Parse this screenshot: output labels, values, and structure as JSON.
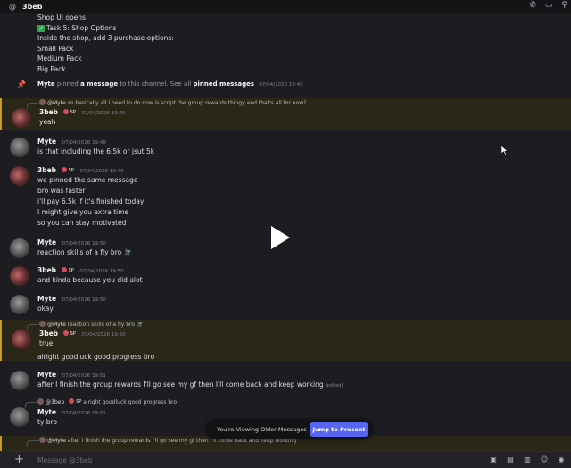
{
  "header": {
    "channel_name": "3beb"
  },
  "top_text": {
    "line1": "Shop UI opens",
    "line2": "Task 5: Shop Options",
    "line3": "Inside the shop, add 3 purchase options:",
    "line4": "Small Pack",
    "line5": "Medium Pack",
    "line6": "Big Pack"
  },
  "pin_notice": {
    "author": "Myte",
    "verb": "pinned",
    "object": "a message",
    "middle": "to this channel. See all",
    "link": "pinned messages",
    "timestamp": "07/04/2026 19:49"
  },
  "messages": {
    "m1": {
      "reply_author": "@Myte",
      "reply_text": "so basically all I need to do now is script the group rewards thingy and that's all for now?",
      "author": "3beb",
      "tag": "SP",
      "timestamp": "07/04/2026 19:49",
      "lines": [
        "yeah"
      ]
    },
    "m2": {
      "author": "Myte",
      "timestamp": "07/04/2026 19:49",
      "lines": [
        "is that including the 6.5k or jsut 5k"
      ]
    },
    "m3": {
      "author": "3beb",
      "tag": "SP",
      "timestamp": "07/04/2026 19:49",
      "lines": [
        "we pinned the same message",
        "bro was faster",
        "i'll pay 6.5k if it's finished today",
        "I might give you extra time",
        "so you can stay motivated"
      ]
    },
    "m4": {
      "author": "Myte",
      "timestamp": "07/04/2026 19:50",
      "lines": [
        "reaction skills of a fly bro 🪰"
      ]
    },
    "m5": {
      "author": "3beb",
      "tag": "SP",
      "timestamp": "07/04/2026 19:50",
      "lines": [
        "and kinda because you did alot"
      ]
    },
    "m6": {
      "author": "Myte",
      "timestamp": "07/04/2026 19:50",
      "lines": [
        "okay"
      ]
    },
    "m7": {
      "reply_author": "@Myte",
      "reply_text": "reaction skills of a fly bro 🪰",
      "author": "3beb",
      "tag": "SP",
      "timestamp": "07/04/2026 19:50",
      "lines": [
        "true",
        "alright goodluck good progress bro"
      ]
    },
    "m8": {
      "author": "Myte",
      "timestamp": "07/04/2026 19:51",
      "lines": [
        "after I finish the group rewards I'll go see my gf then I'll come back and keep working"
      ],
      "edited": "(edited)"
    },
    "m9": {
      "reply_author": "@3beb",
      "reply_tag": "SP",
      "reply_text": "alright goodluck good progress bro",
      "author": "Myte",
      "timestamp": "07/04/2026 19:51",
      "lines": [
        "ty bro"
      ]
    },
    "m10": {
      "reply_author": "@Myte",
      "reply_text": "after I finish the group rewards I'll go see my gf then I'll come back and keep working"
    }
  },
  "banner": {
    "text": "You're Viewing Older Messages",
    "button": "Jump to Present"
  },
  "composer": {
    "placeholder": "Message @3beb"
  },
  "colors": {
    "background": "#1c1c21",
    "highlight": "#2a2718",
    "highlight_bar": "#c99b2c",
    "accent": "#5865f2"
  }
}
